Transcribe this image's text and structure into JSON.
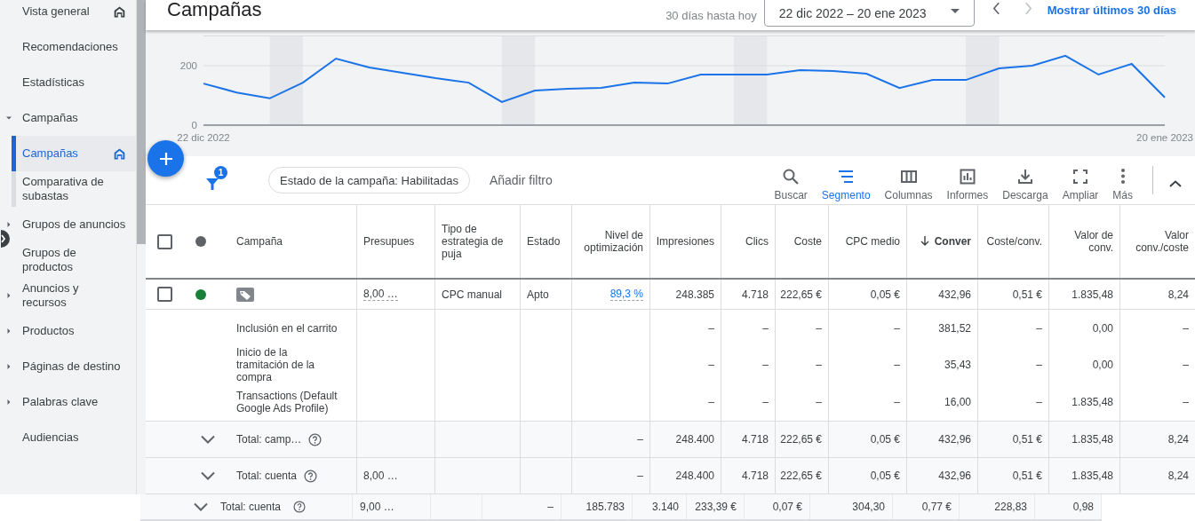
{
  "sidebar": {
    "items": [
      {
        "label": "Vista general",
        "selected": false,
        "pinned": true
      },
      {
        "label": "Recomendaciones",
        "selected": false,
        "pinned": false
      },
      {
        "label": "Estadísticas",
        "selected": false,
        "pinned": false
      },
      {
        "label": "Campañas",
        "selected": false,
        "pinned": false,
        "expanded": true,
        "children": [
          {
            "label": "Campañas",
            "selected": true,
            "pinned": true
          },
          {
            "label": "Comparativa de subastas",
            "selected": false,
            "pinned": false
          }
        ]
      },
      {
        "label": "Grupos de anuncios",
        "selected": false,
        "pinned": false,
        "expanded": false
      },
      {
        "label": "Grupos de productos",
        "selected": false,
        "pinned": false
      },
      {
        "label": "Anuncios y recursos",
        "selected": false,
        "pinned": false,
        "expanded": false
      },
      {
        "label": "Productos",
        "selected": false,
        "pinned": false,
        "expanded": false
      },
      {
        "label": "Páginas de destino",
        "selected": false,
        "pinned": false,
        "expanded": false
      },
      {
        "label": "Palabras clave",
        "selected": false,
        "pinned": false,
        "expanded": false
      },
      {
        "label": "Audiencias",
        "selected": false,
        "pinned": false
      }
    ]
  },
  "header": {
    "title": "Campañas",
    "range_label": "30 días hasta hoy",
    "date_range": "22 dic 2022 – 20 ene 2023",
    "prev_disabled": false,
    "next_disabled": true,
    "link": "Mostrar últimos 30 días"
  },
  "chart": {
    "chart_data": {
      "type": "line",
      "categories": [
        "22 dic 2022",
        null,
        null,
        null,
        null,
        null,
        null,
        null,
        null,
        null,
        null,
        null,
        null,
        null,
        null,
        null,
        null,
        null,
        null,
        null,
        null,
        null,
        null,
        null,
        null,
        null,
        null,
        null,
        null,
        "20 ene 2023"
      ],
      "ylim": [
        0,
        300
      ],
      "yticks": [
        0,
        200
      ],
      "series": [
        {
          "color": "#1a73e8",
          "values": [
            140,
            110,
            90,
            143,
            224,
            194,
            176,
            158,
            143,
            78,
            116,
            122,
            125,
            143,
            140,
            170,
            170,
            170,
            185,
            182,
            173,
            125,
            152,
            152,
            191,
            200,
            233,
            170,
            206,
            93
          ]
        }
      ]
    }
  },
  "toolbar": {
    "filter_count": "1",
    "filter_chip": "Estado de la campaña: Habilitadas",
    "add_filter": "Añadir filtro",
    "tools": [
      {
        "label": "Buscar",
        "selected": false
      },
      {
        "label": "Segmento",
        "selected": true
      },
      {
        "label": "Columnas",
        "selected": false
      },
      {
        "label": "Informes",
        "selected": false
      },
      {
        "label": "Descarga",
        "selected": false
      },
      {
        "label": "Ampliar",
        "selected": false
      },
      {
        "label": "Más",
        "selected": false
      }
    ]
  },
  "table": {
    "select_all_checked": false,
    "columns": [
      {
        "label": "Campaña",
        "sorted": false
      },
      {
        "label": "Presupues",
        "sorted": false
      },
      {
        "label": "Tipo de estrategia de puja",
        "sorted": false
      },
      {
        "label": "Estado",
        "sorted": false
      },
      {
        "label": "Nivel de optimización",
        "sorted": false
      },
      {
        "label": "Impresiones",
        "sorted": false
      },
      {
        "label": "Clics",
        "sorted": false
      },
      {
        "label": "Coste",
        "sorted": false
      },
      {
        "label": "CPC medio",
        "sorted": false
      },
      {
        "label": "Conver",
        "sorted": true
      },
      {
        "label": "Coste/conv.",
        "sorted": false
      },
      {
        "label": "Valor de conv.",
        "sorted": false
      },
      {
        "label": "Valor conv./coste",
        "sorted": false
      }
    ],
    "rows": [
      {
        "kind": "campaign",
        "checked": false,
        "color": "#188038",
        "cells": [
          null,
          "8,00 …",
          "CPC manual",
          "Apto",
          "89,3 %",
          "248.385",
          "4.718",
          "222,65 €",
          "0,05 €",
          "432,96",
          "0,51 €",
          "1.835,48",
          "8,24"
        ]
      },
      {
        "kind": "segment",
        "cells": [
          "Inclusión en el carrito",
          null,
          null,
          null,
          null,
          "–",
          "–",
          "–",
          "–",
          "381,52",
          "–",
          "0,00",
          "–"
        ]
      },
      {
        "kind": "segment",
        "cells": [
          "Inicio de la tramitación de la compra",
          null,
          null,
          null,
          null,
          "–",
          "–",
          "–",
          "–",
          "35,43",
          "–",
          "0,00",
          "–"
        ]
      },
      {
        "kind": "segment",
        "cells": [
          "Transactions (Default Google Ads Profile)",
          null,
          null,
          null,
          null,
          "–",
          "–",
          "–",
          "–",
          "16,00",
          "–",
          "1.835,48",
          "–"
        ]
      },
      {
        "kind": "total",
        "cells": [
          "Total: camp…",
          null,
          null,
          null,
          "–",
          "248.400",
          "4.718",
          "222,65 €",
          "0,05 €",
          "432,96",
          "0,51 €",
          "1.835,48",
          "8,24"
        ]
      },
      {
        "kind": "total",
        "cells": [
          "Total: cuenta",
          "8,00 …",
          null,
          null,
          "–",
          "248.400",
          "4.718",
          "222,65 €",
          "0,05 €",
          "432,96",
          "0,51 €",
          "1.835,48",
          "8,24"
        ]
      }
    ],
    "ghost_row": {
      "label": "Total: cuenta",
      "cells": [
        "9,00 …",
        null,
        "–",
        "185.783",
        "3.140",
        "233,39 €",
        "0,07 €",
        "304,30",
        "0,77 €",
        "228,83",
        "0,98"
      ]
    }
  }
}
